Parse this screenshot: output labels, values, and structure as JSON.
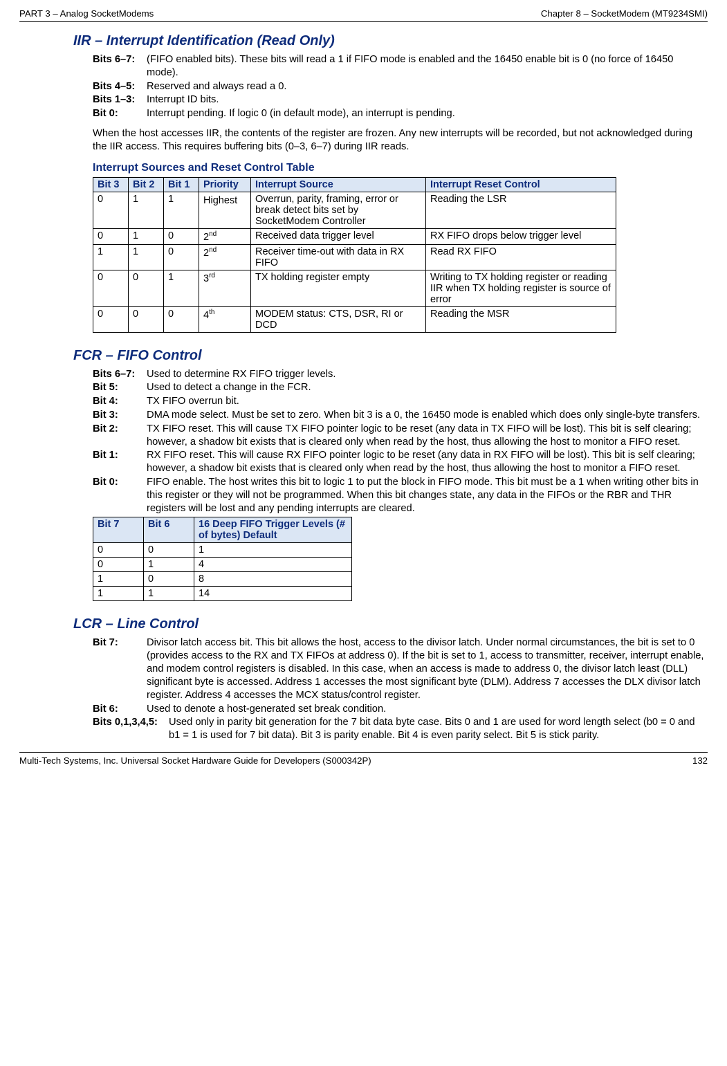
{
  "header": {
    "left": "PART 3 – Analog SocketModems",
    "right": "Chapter 8 – SocketModem (MT9234SMI)"
  },
  "iir": {
    "title": "IIR – Interrupt Identification (Read Only)",
    "bits": [
      {
        "label": "Bits 6–7:",
        "text": "(FIFO enabled bits). These bits will read a 1 if FIFO mode is enabled and the 16450 enable bit is 0 (no force of 16450 mode)."
      },
      {
        "label": "Bits 4–5:",
        "text": "Reserved and always read a 0."
      },
      {
        "label": "Bits 1–3:",
        "text": "Interrupt ID bits."
      },
      {
        "label": "Bit 0:",
        "text": "Interrupt pending. If logic 0 (in default mode), an interrupt is pending."
      }
    ],
    "para": "When the host accesses IIR, the contents of the register are frozen. Any new interrupts will be recorded, but not acknowledged during the IIR access. This requires buffering bits (0–3, 6–7) during IIR reads.",
    "table_title": "Interrupt Sources and Reset Control Table",
    "table_headers": [
      "Bit 3",
      "Bit 2",
      "Bit 1",
      "Priority",
      "Interrupt Source",
      "Interrupt Reset Control"
    ],
    "table_rows": [
      {
        "b3": "0",
        "b2": "1",
        "b1": "1",
        "prio": "Highest",
        "prio_sup": "",
        "src": "Overrun, parity, framing, error or break detect bits set by SocketModem Controller",
        "reset": "Reading the LSR"
      },
      {
        "b3": "0",
        "b2": "1",
        "b1": "0",
        "prio": "2",
        "prio_sup": "nd",
        "src": "Received data trigger level",
        "reset": "RX FIFO drops below trigger level"
      },
      {
        "b3": "1",
        "b2": "1",
        "b1": "0",
        "prio": "2",
        "prio_sup": "nd",
        "src": "Receiver time-out with data in RX FIFO",
        "reset": "Read RX FIFO"
      },
      {
        "b3": "0",
        "b2": "0",
        "b1": "1",
        "prio": "3",
        "prio_sup": "rd",
        "src": "TX holding register empty",
        "reset": "Writing to TX holding register or reading IIR when TX holding register is source of error"
      },
      {
        "b3": "0",
        "b2": "0",
        "b1": "0",
        "prio": "4",
        "prio_sup": "th",
        "src": "MODEM status: CTS, DSR, RI or DCD",
        "reset": "Reading the MSR"
      }
    ]
  },
  "fcr": {
    "title": "FCR – FIFO Control",
    "bits": [
      {
        "label": "Bits 6–7:",
        "text": "Used to determine RX FIFO trigger levels."
      },
      {
        "label": "Bit 5:",
        "text": "Used to detect a change in the FCR."
      },
      {
        "label": "Bit 4:",
        "text": "TX FIFO overrun bit."
      },
      {
        "label": "Bit 3:",
        "text": "DMA mode select. Must be set to zero. When bit 3 is a 0, the 16450 mode is enabled which does only single-byte transfers."
      },
      {
        "label": "Bit 2:",
        "text": "TX FIFO reset. This will cause TX FIFO pointer logic to be reset (any data in TX FIFO will be lost). This bit is self clearing; however, a shadow bit exists that is cleared only when read by the host, thus allowing the host to monitor a FIFO reset."
      },
      {
        "label": "Bit 1:",
        "text": "RX FIFO reset. This will cause RX FIFO pointer logic to be reset (any data in RX FIFO will be lost). This bit is self clearing; however, a shadow bit exists that is cleared only when read by the host, thus allowing the host to monitor a FIFO reset."
      },
      {
        "label": "Bit 0:",
        "text": "FIFO enable. The host writes this bit to logic 1 to put the block in FIFO mode. This bit must be a 1 when writing other bits in this register or they will not be programmed. When this bit changes state, any data in the FIFOs or the RBR and THR registers will be lost and any pending interrupts are cleared."
      }
    ],
    "table_headers": [
      "Bit 7",
      "Bit 6",
      "16 Deep FIFO Trigger Levels (# of bytes) Default"
    ],
    "table_rows": [
      {
        "b7": "0",
        "b6": "0",
        "lvl": "1"
      },
      {
        "b7": "0",
        "b6": "1",
        "lvl": "4"
      },
      {
        "b7": "1",
        "b6": "0",
        "lvl": "8"
      },
      {
        "b7": "1",
        "b6": "1",
        "lvl": "14"
      }
    ]
  },
  "lcr": {
    "title": "LCR – Line Control",
    "bits": [
      {
        "label": "Bit 7:",
        "text": "Divisor latch access bit. This bit allows the host, access to the divisor latch. Under normal circumstances, the bit is set to 0 (provides access to the RX and TX FIFOs at address 0). If the bit is set to 1, access to transmitter, receiver, interrupt enable, and modem control registers is disabled. In this case, when an access is made to address 0, the divisor latch least (DLL) significant byte is accessed. Address 1 accesses the most significant byte (DLM). Address 7 accesses the DLX divisor latch register. Address 4 accesses the MCX status/control register."
      },
      {
        "label": "Bit 6:",
        "text": "Used to denote a host-generated set break condition."
      },
      {
        "label": "Bits 0,1,3,4,5:",
        "text": "Used only in parity bit generation for the 7 bit data byte case. Bits 0 and 1 are used for word length select (b0 = 0 and b1 = 1 is used for 7 bit data). Bit 3 is parity enable. Bit 4 is even parity select.  Bit 5 is stick parity."
      }
    ]
  },
  "footer": {
    "left": "Multi-Tech Systems, Inc. Universal Socket Hardware Guide for Developers (S000342P)",
    "right": "132"
  }
}
